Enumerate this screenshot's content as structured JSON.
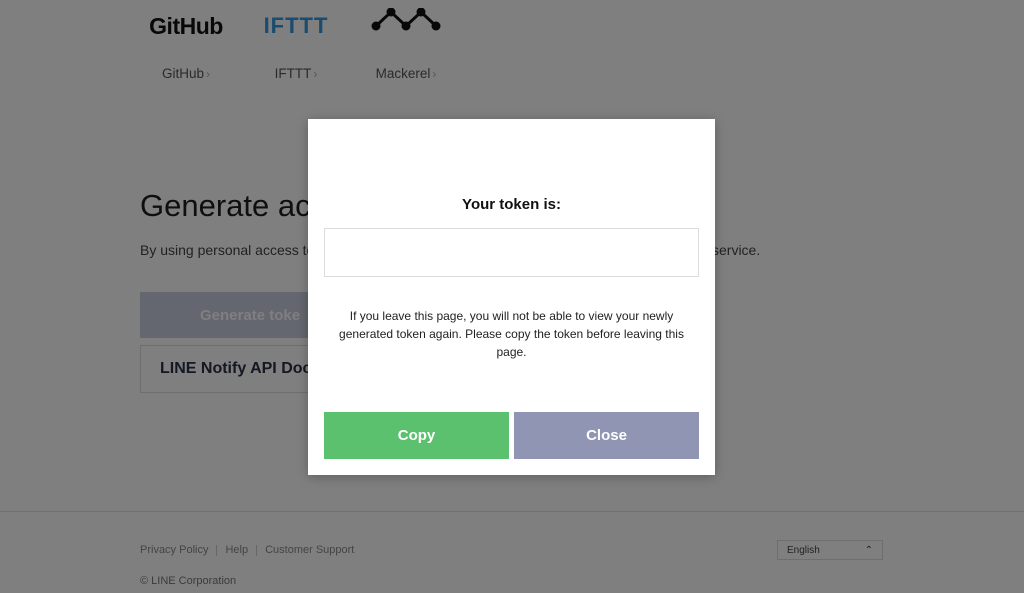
{
  "services": [
    {
      "logo": "GitHub",
      "label": "GitHub"
    },
    {
      "logo": "IFTTT",
      "label": "IFTTT"
    },
    {
      "logo": "mackerel-logo-icon",
      "label": "Mackerel"
    }
  ],
  "main": {
    "heading": "Generate acc",
    "description": "By using personal access to",
    "description_tail": "service.",
    "generate_button": "Generate toke",
    "docs_button": "LINE Notify API Doc"
  },
  "footer": {
    "links": [
      "Privacy Policy",
      "Help",
      "Customer Support"
    ],
    "copyright": "© LINE Corporation",
    "language": "English"
  },
  "modal": {
    "title": "Your token is:",
    "token_value": "",
    "note": "If you leave this page, you will not be able to view your newly generated token again. Please copy the token before leaving this page.",
    "copy_button": "Copy",
    "close_button": "Close"
  },
  "colors": {
    "copy_button": "#5bc16e",
    "close_button": "#9095b4",
    "generate_button": "#c8cce0",
    "overlay": "rgba(0,0,0,0.5)"
  }
}
